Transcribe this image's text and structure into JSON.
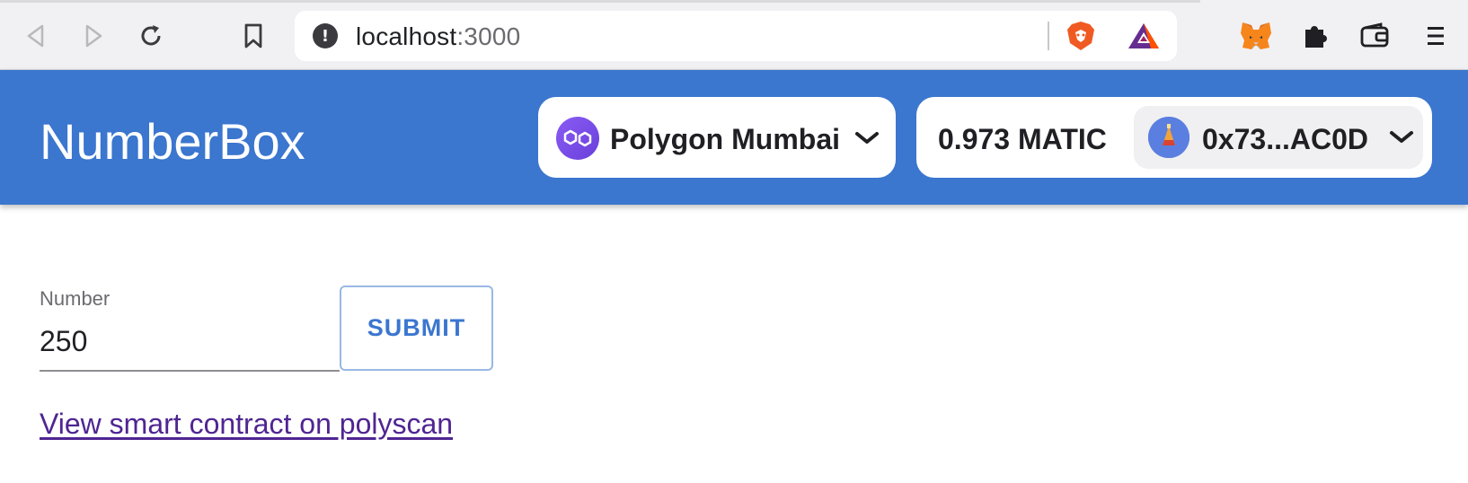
{
  "browser": {
    "url_host": "localhost",
    "url_port": ":3000",
    "icons": [
      "back-icon",
      "forward-icon",
      "reload-icon",
      "bookmark-icon",
      "site-info-icon",
      "brave-shields-icon",
      "brave-rewards-icon",
      "metamask-icon",
      "extensions-icon",
      "wallet-icon",
      "menu-icon"
    ]
  },
  "header": {
    "app_title": "NumberBox",
    "network_name": "Polygon Mumbai",
    "balance": "0.973 MATIC",
    "address": "0x73...AC0D"
  },
  "form": {
    "label": "Number",
    "value": "250",
    "submit_label": "SUBMIT"
  },
  "link": {
    "text": "View smart contract on polyscan"
  },
  "colors": {
    "header_bg": "#3b76cf",
    "link": "#4f2592",
    "button_text": "#3b76cf"
  }
}
